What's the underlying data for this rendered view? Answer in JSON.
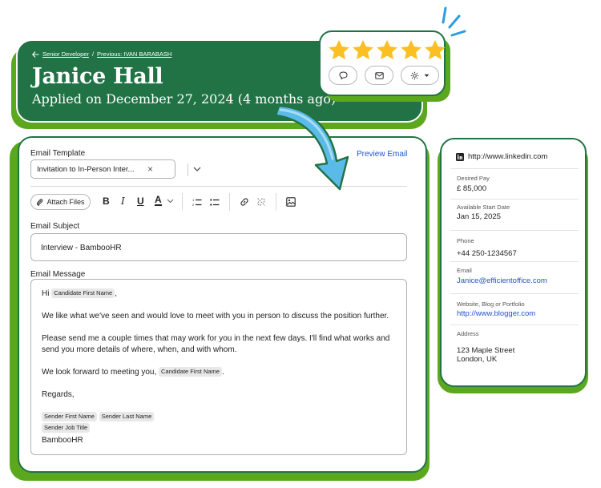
{
  "header": {
    "breadcrumb_back_icon": "arrow-left-icon",
    "breadcrumb_job": "Senior Developer",
    "breadcrumb_sep": "/",
    "breadcrumb_prev": "Previous: IVAN BARABASH",
    "candidate_name": "Janice Hall",
    "applied_text": "Applied on December 27, 2024 (4 months ago)",
    "bg_color": "#217345",
    "accent_color": "#5ba81e"
  },
  "rating": {
    "stars_filled": 5,
    "stars_total": 5,
    "star_color": "#fbbf24",
    "buttons": [
      {
        "icon": "comment-icon"
      },
      {
        "icon": "mail-icon"
      },
      {
        "icon": "gear-icon",
        "dropdown": "chevron-down-icon"
      }
    ]
  },
  "email": {
    "template_label": "Email Template",
    "template_value": "Invitation to In-Person Inter...",
    "clear_icon": "close-icon",
    "preview_label": "Preview Email",
    "toolbar": {
      "attach_label": "Attach Files",
      "bold": "B",
      "italic": "I",
      "underline": "U",
      "font_color": "A"
    },
    "subject_label": "Email Subject",
    "subject_value": "Interview - BambooHR",
    "message_label": "Email Message",
    "message": {
      "greeting": "Hi",
      "token_first_name": "Candidate First Name",
      "greeting_end": ",",
      "p1": "We like what we've seen and would love to meet with you in person to discuss the position further.",
      "p2a": "Please send me a couple times that may work for you in the next few days. I'll find what works and",
      "p2b": "send you more details of where, when, and with whom.",
      "p3": "We look forward to meeting you,",
      "p3_token": "Candidate First Name",
      "p3_end": ".",
      "regards": "Regards,",
      "sender_first": "Sender First Name",
      "sender_last": "Sender Last Name",
      "sender_title": "Sender Job Title",
      "company": "BambooHR"
    },
    "link_color": "#2354c4"
  },
  "sidebar": {
    "linkedin": "http://www.linkedin.com",
    "desired_pay_label": "Desired Pay",
    "desired_pay": "£ 85,000",
    "start_date_label": "Available Start Date",
    "start_date": "Jan 15, 2025",
    "phone_label": "Phone",
    "phone": "+44 250-1234567",
    "email_label": "Email",
    "email": "Janice@efficientoffice.com",
    "website_label": "Website, Blog or Portfolio",
    "website": "http://www.blogger.com",
    "address_label": "Address",
    "address_line1": "123 Maple Street",
    "address_line2": "London, UK"
  }
}
